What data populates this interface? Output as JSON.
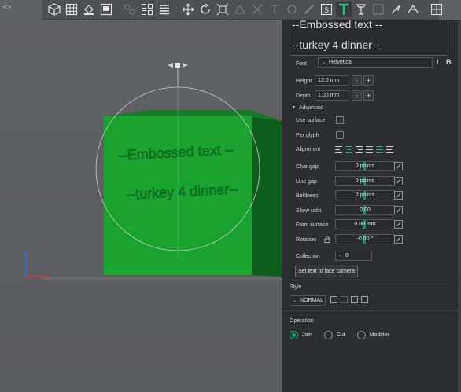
{
  "viewport": {
    "embossed_lines": [
      "--Embossed text --",
      "--turkey 4 dinner--"
    ],
    "cube_color": "#1aa32f"
  },
  "toolbar": {
    "icons": [
      "cube-view-icon",
      "grid-icon",
      "paint-bucket-icon",
      "layout-icon",
      "arrange-icon",
      "layers-icon",
      "move-icon",
      "rotate-icon",
      "scale-icon",
      "support-icon",
      "seam-icon",
      "text-tool-icon",
      "measure-icon",
      "assembly-icon",
      "cut-icon",
      "split-icon"
    ]
  },
  "panel": {
    "text_lines": [
      "--Embossed text --",
      "--turkey 4 dinner--"
    ],
    "font_label": "Font",
    "font_value": "Helvetica",
    "italic_label": "I",
    "bold_label": "B",
    "height_label": "Height",
    "height_value": "13.0 mm",
    "depth_label": "Depth",
    "depth_value": "1.00 mm",
    "minus": "-",
    "plus": "+",
    "advanced_label": "Advanced",
    "advanced_arrow": "▼",
    "use_surface_label": "Use surface",
    "per_glyph_label": "Per glyph",
    "alignment_label": "Alignment",
    "char_gap_label": "Char gap",
    "char_gap_value": "0 points",
    "line_gap_label": "Line gap",
    "line_gap_value": "0 points",
    "boldness_label": "Boldness",
    "boldness_value": "0 points",
    "skew_label": "Skew ratio",
    "skew_value": "0.00",
    "from_surface_label": "From surface",
    "from_surface_value": "0.00 mm",
    "rotation_label": "Rotation",
    "rotation_value": "-0.00 °",
    "collection_label": "Collection",
    "collection_value": "0",
    "face_camera_button": "Set text to face camera",
    "style_label": "Style",
    "style_value": "NORMAL",
    "operation_label": "Operation",
    "op_join": "Join",
    "op_cut": "Cut",
    "op_modifier": "Modifier"
  },
  "colors": {
    "accent": "#1fa875",
    "panel_bg": "#2d2e31",
    "toolbar_bg": "#4f5054"
  }
}
